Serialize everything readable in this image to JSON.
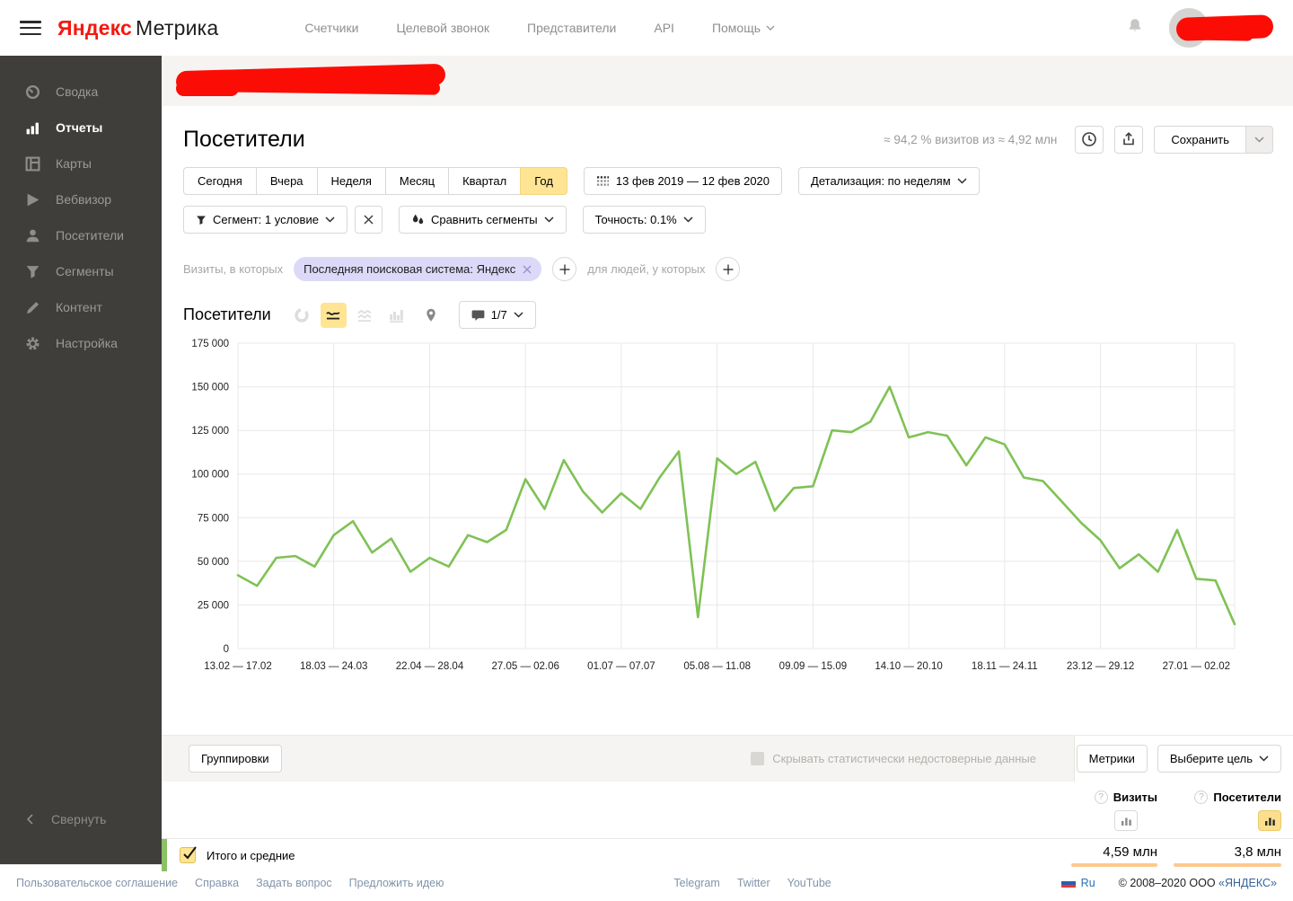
{
  "topbar": {
    "logo_brand": "Яндекс",
    "logo_product": "Метрика",
    "nav": [
      {
        "label": "Счетчики"
      },
      {
        "label": "Целевой звонок"
      },
      {
        "label": "Представители"
      },
      {
        "label": "API"
      },
      {
        "label": "Помощь"
      }
    ]
  },
  "sidebar": {
    "items": [
      {
        "label": "Сводка",
        "icon": "gauge-icon"
      },
      {
        "label": "Отчеты",
        "icon": "bar-chart-icon",
        "active": true
      },
      {
        "label": "Карты",
        "icon": "maps-icon"
      },
      {
        "label": "Вебвизор",
        "icon": "play-icon"
      },
      {
        "label": "Посетители",
        "icon": "person-icon"
      },
      {
        "label": "Сегменты",
        "icon": "funnel-icon"
      },
      {
        "label": "Контент",
        "icon": "pencil-icon"
      },
      {
        "label": "Настройка",
        "icon": "gear-icon"
      }
    ],
    "collapse_label": "Свернуть"
  },
  "header": {
    "title": "Посетители",
    "sampling_note": "≈ 94,2 % визитов из ≈ 4,92 млн",
    "save_label": "Сохранить"
  },
  "period_tabs": {
    "items": [
      "Сегодня",
      "Вчера",
      "Неделя",
      "Месяц",
      "Квартал",
      "Год"
    ],
    "active": "Год"
  },
  "date_range": "13 фев 2019 — 12 фев 2020",
  "detail_label": "Детализация: по неделям",
  "segment_controls": {
    "segment_label": "Сегмент: 1 условие",
    "compare_label": "Сравнить сегменты",
    "accuracy_label": "Точность: 0.1%"
  },
  "filter_row": {
    "visits_prefix": "Визиты, в которых",
    "chip_label": "Последняя поисковая система: Яндекс",
    "people_prefix": "для людей, у которых"
  },
  "chart_toolbar": {
    "label": "Посетители",
    "annotations_count": "1/7"
  },
  "chart_data": {
    "type": "line",
    "title": "Посетители",
    "x_tick_labels": [
      "13.02 — 17.02",
      "18.03 — 24.03",
      "22.04 — 28.04",
      "27.05 — 02.06",
      "01.07 — 07.07",
      "05.08 — 11.08",
      "09.09 — 15.09",
      "14.10 — 20.10",
      "18.11 — 24.11",
      "23.12 — 29.12",
      "27.01 — 02.02"
    ],
    "x_tick_step": 5,
    "y_ticks": [
      0,
      25000,
      50000,
      75000,
      100000,
      125000,
      150000,
      175000
    ],
    "ylim": [
      0,
      175000
    ],
    "grid": true,
    "legend_position": "none",
    "series": [
      {
        "name": "Посетители",
        "color": "#7fc255",
        "values": [
          42000,
          36000,
          52000,
          53000,
          47000,
          65000,
          73000,
          55000,
          63000,
          44000,
          52000,
          47000,
          65000,
          61000,
          68000,
          97000,
          80000,
          108000,
          90000,
          78000,
          89000,
          80000,
          98000,
          113000,
          18000,
          109000,
          100000,
          107000,
          79000,
          92000,
          93000,
          125000,
          124000,
          130000,
          150000,
          121000,
          124000,
          122000,
          105000,
          121000,
          117000,
          98000,
          96000,
          84000,
          72000,
          62000,
          46000,
          54000,
          44000,
          68000,
          40000,
          39000,
          14000
        ]
      }
    ]
  },
  "bottom": {
    "groupings_label": "Группировки",
    "hide_inaccurate_label": "Скрывать статистически недостоверные данные",
    "metrics_label": "Метрики",
    "goal_label": "Выберите цель",
    "help_glyph": "?",
    "columns": [
      {
        "label": "Визиты",
        "value": "4,59 млн",
        "selected": false
      },
      {
        "label": "Посетители",
        "value": "3,8 млн",
        "selected": true
      }
    ],
    "total_row_label": "Итого и средние"
  },
  "footer": {
    "links": [
      "Пользовательское соглашение",
      "Справка",
      "Задать вопрос",
      "Предложить идею"
    ],
    "social": [
      "Telegram",
      "Twitter",
      "YouTube"
    ],
    "lang": "Ru",
    "copyright": "© 2008–2020 ООО",
    "copyright_brand": "«ЯНДЕКС»"
  },
  "colors": {
    "accent_yellow": "#ffe493",
    "line_green": "#7fc255",
    "brand_red": "#f5180f",
    "bar_orange": "#fdc98e",
    "chip_purple": "#dcd9f8",
    "sidebar_bg": "#403e3b"
  }
}
